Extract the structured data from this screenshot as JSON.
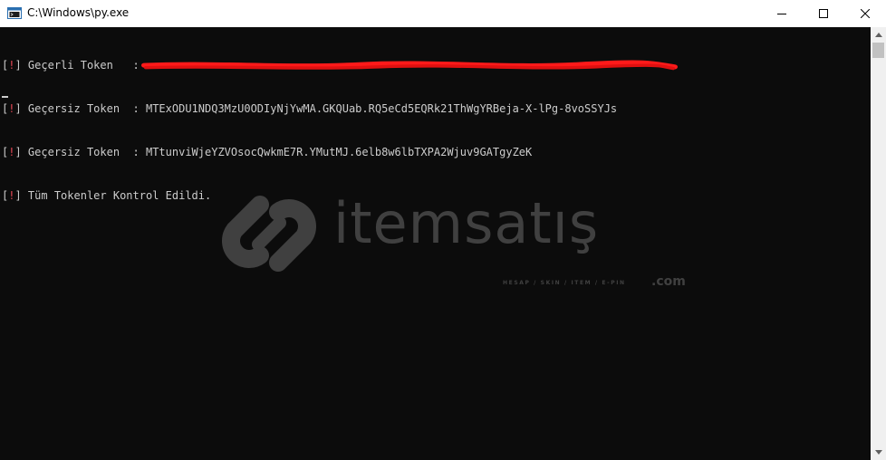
{
  "window": {
    "title": "C:\\Windows\\py.exe"
  },
  "icons": {
    "app": "console-window-icon",
    "minimize": "minimize-icon",
    "maximize": "maximize-icon",
    "close": "close-icon"
  },
  "console": {
    "lines": [
      {
        "bracket_open": "[",
        "mark": "!",
        "bracket_close": "]",
        "label": " Geçerli Token   : ",
        "value": "",
        "redacted": true
      },
      {
        "bracket_open": "[",
        "mark": "!",
        "bracket_close": "]",
        "label": " Geçersiz Token  : ",
        "value": "MTExODU1NDQ3MzU0ODIyNjYwMA.GKQUab.RQ5eCd5EQRk21ThWgYRBeja-X-lPg-8voSSYJs",
        "redacted": false
      },
      {
        "bracket_open": "[",
        "mark": "!",
        "bracket_close": "]",
        "label": " Geçersiz Token  : ",
        "value": "MTtunviWjeYZVOsocQwkmE7R.YMutMJ.6elb8w6lbTXPA2Wjuv9GATgyZeK",
        "redacted": false
      },
      {
        "bracket_open": "[",
        "mark": "!",
        "bracket_close": "]",
        "label": " Tüm Tokenler Kontrol Edildi.",
        "value": "",
        "redacted": false
      }
    ]
  },
  "watermark": {
    "brand": "itemsatış",
    "tagline": "HESAP / SKIN / ITEM / E-PIN",
    "domain": ".com"
  },
  "colors": {
    "console_bg": "#0c0c0c",
    "console_text": "#cccccc",
    "exclamation": "#e74856",
    "redaction": "#ff1a1a",
    "watermark": "#404040"
  }
}
